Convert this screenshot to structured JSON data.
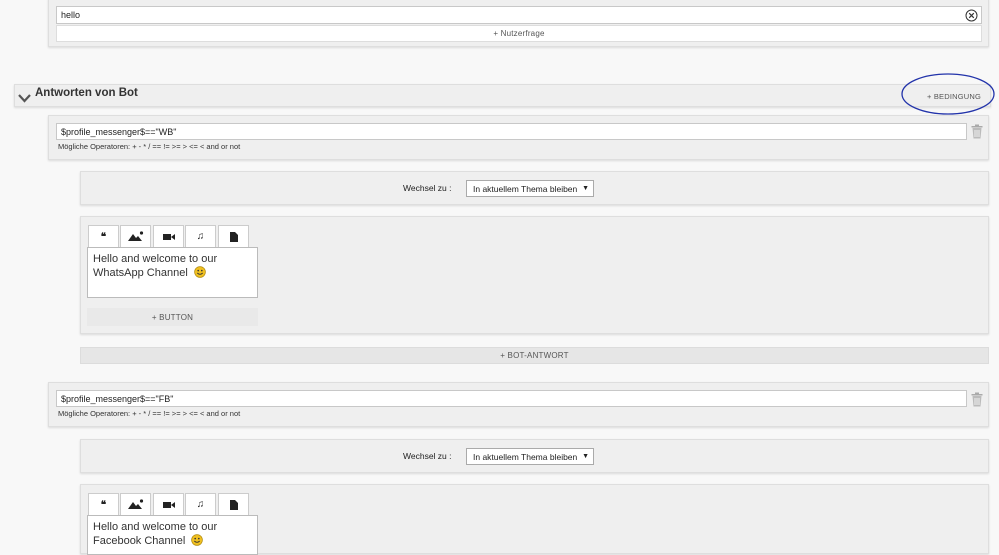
{
  "top": {
    "input_value": "hello",
    "add_user_question": "+ Nutzerfrage"
  },
  "section": {
    "title": "Antworten von Bot",
    "add_condition": "+ BEDINGUNG"
  },
  "conditions": [
    {
      "expression": "$profile_messenger$==\"WB\"",
      "operators_hint": "Mögliche Operatoren: + - * / == != >= > <= < and or not",
      "switch_label": "Wechsel zu :",
      "switch_value": "In aktuellem Thema bleiben",
      "message_text": "Hello and welcome to our WhatsApp Channel",
      "add_button": "+ BUTTON",
      "add_bot_answer": "+ BOT-ANTWORT"
    },
    {
      "expression": "$profile_messenger$==\"FB\"",
      "operators_hint": "Mögliche Operatoren: + - * / == != >= > <= < and or not",
      "switch_label": "Wechsel zu :",
      "switch_value": "In aktuellem Thema bleiben",
      "message_text": "Hello and welcome to our Facebook Channel"
    }
  ],
  "icons": {
    "emoji": "smiley-face-icon",
    "tabs": [
      "quote-icon",
      "image-icon",
      "video-icon",
      "music-icon",
      "document-icon"
    ],
    "delete": "trash-icon",
    "clear": "clear-circle-icon",
    "collapse": "chevron-down-icon"
  },
  "colors": {
    "highlight_ellipse": "#2233aa",
    "emoji": "#f0c020"
  }
}
